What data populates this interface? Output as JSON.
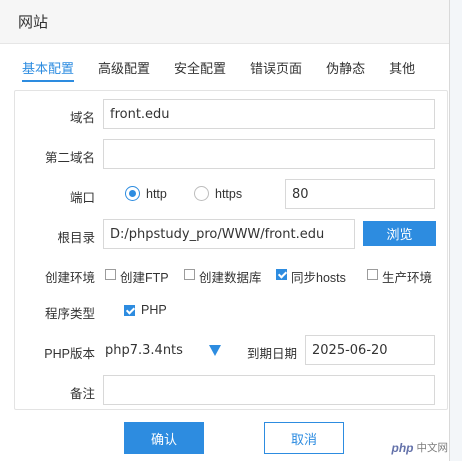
{
  "dialog": {
    "title": "网站"
  },
  "tabs": [
    {
      "label": "基本配置",
      "active": true
    },
    {
      "label": "高级配置"
    },
    {
      "label": "安全配置"
    },
    {
      "label": "错误页面"
    },
    {
      "label": "伪静态"
    },
    {
      "label": "其他"
    }
  ],
  "form": {
    "domain": {
      "label": "域名",
      "value": "front.edu"
    },
    "second_domain": {
      "label": "第二域名",
      "value": ""
    },
    "port": {
      "label": "端口",
      "options": [
        {
          "label": "http",
          "checked": true
        },
        {
          "label": "https",
          "checked": false
        }
      ],
      "value": "80"
    },
    "root": {
      "label": "根目录",
      "value": "D:/phpstudy_pro/WWW/front.edu",
      "browse_label": "浏览"
    },
    "create_env": {
      "label": "创建环境",
      "options": [
        {
          "label": "创建FTP",
          "checked": false
        },
        {
          "label": "创建数据库",
          "checked": false
        },
        {
          "label": "同步hosts",
          "checked": true
        },
        {
          "label": "生产环境",
          "checked": false
        }
      ]
    },
    "program_type": {
      "label": "程序类型",
      "option": {
        "label": "PHP",
        "checked": true
      }
    },
    "php_version": {
      "label": "PHP版本",
      "value": "php7.3.4nts"
    },
    "expire": {
      "label": "到期日期",
      "value": "2025-06-20"
    },
    "note": {
      "label": "备注",
      "value": ""
    }
  },
  "buttons": {
    "ok": "确认",
    "cancel": "取消"
  },
  "watermark": {
    "brand": "php",
    "site": "中文网"
  },
  "colors": {
    "accent": "#2d8ce0"
  }
}
